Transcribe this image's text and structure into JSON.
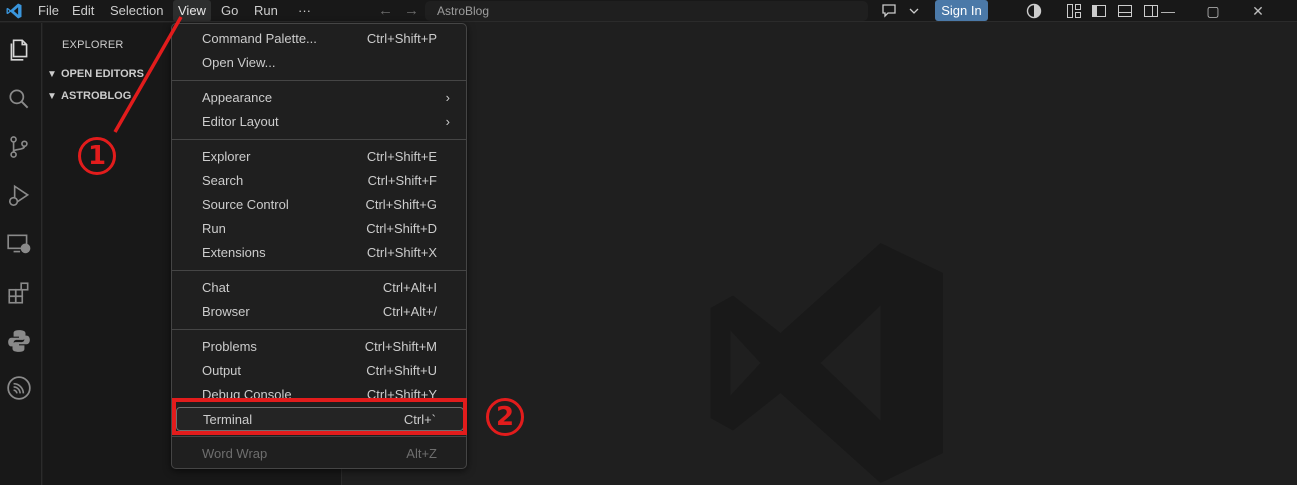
{
  "titlebar": {
    "menus": [
      "File",
      "Edit",
      "Selection",
      "View",
      "Go",
      "Run",
      "···"
    ],
    "active_menu": "View",
    "back_arrow": "←",
    "forward_arrow": "→",
    "search_text": "AstroBlog",
    "sign_in": "Sign In",
    "window_controls": [
      "—",
      "▢",
      "✕"
    ]
  },
  "sidebar": {
    "title": "EXPLORER",
    "sections": [
      "OPEN EDITORS",
      "ASTROBLOG"
    ]
  },
  "view_menu": {
    "groups": [
      [
        {
          "label": "Command Palette...",
          "shortcut": "Ctrl+Shift+P"
        },
        {
          "label": "Open View...",
          "shortcut": ""
        }
      ],
      [
        {
          "label": "Appearance",
          "shortcut": "",
          "submenu": true
        },
        {
          "label": "Editor Layout",
          "shortcut": "",
          "submenu": true
        }
      ],
      [
        {
          "label": "Explorer",
          "shortcut": "Ctrl+Shift+E"
        },
        {
          "label": "Search",
          "shortcut": "Ctrl+Shift+F"
        },
        {
          "label": "Source Control",
          "shortcut": "Ctrl+Shift+G"
        },
        {
          "label": "Run",
          "shortcut": "Ctrl+Shift+D"
        },
        {
          "label": "Extensions",
          "shortcut": "Ctrl+Shift+X"
        }
      ],
      [
        {
          "label": "Chat",
          "shortcut": "Ctrl+Alt+I"
        },
        {
          "label": "Browser",
          "shortcut": "Ctrl+Alt+/"
        }
      ],
      [
        {
          "label": "Problems",
          "shortcut": "Ctrl+Shift+M"
        },
        {
          "label": "Output",
          "shortcut": "Ctrl+Shift+U"
        },
        {
          "label": "Debug Console",
          "shortcut": "Ctrl+Shift+Y"
        },
        {
          "label": "Terminal",
          "shortcut": "Ctrl+`",
          "focused": true
        }
      ],
      [
        {
          "label": "Word Wrap",
          "shortcut": "Alt+Z",
          "disabled": true
        }
      ]
    ],
    "submenu_glyph": "›"
  },
  "annotations": {
    "step1": "1",
    "step2": "2",
    "color": "#e21c1c"
  },
  "colors": {
    "accent_button": "#4b79a8",
    "background": "#1f1f1f",
    "sidebar": "#181818"
  }
}
